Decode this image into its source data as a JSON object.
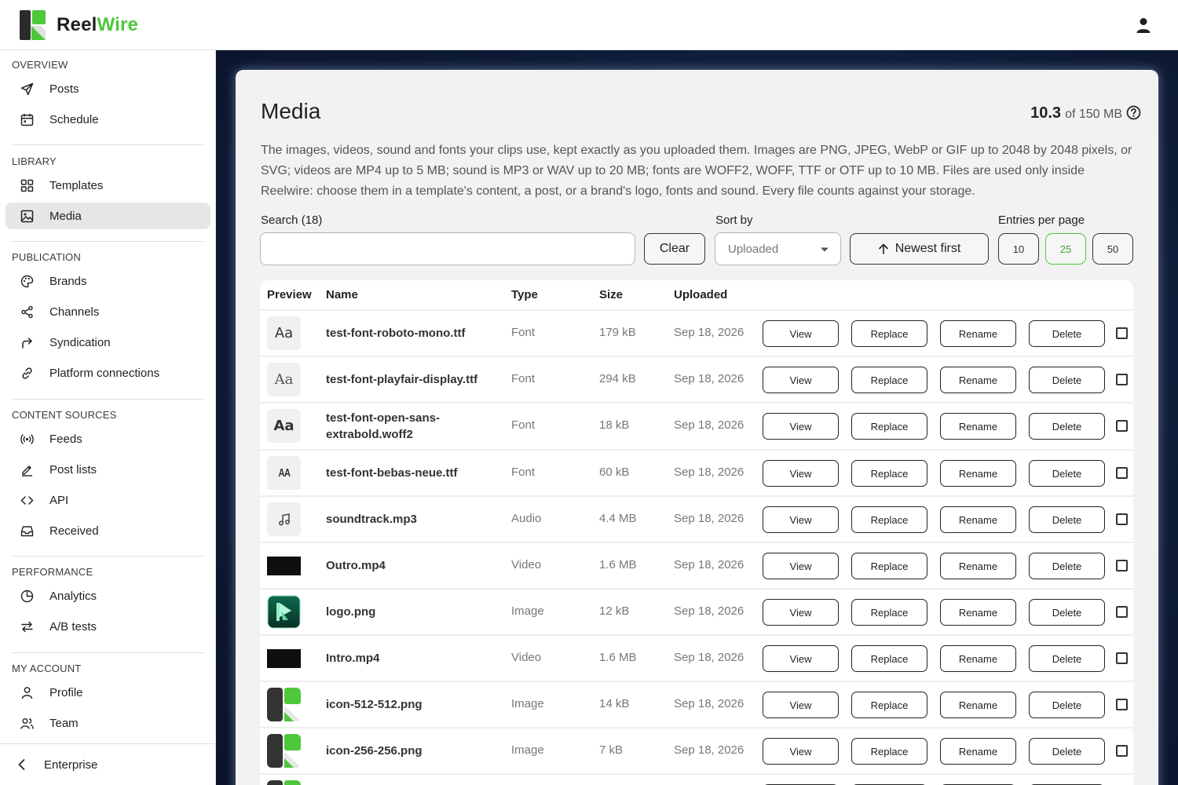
{
  "header": {
    "brand_first": "Reel",
    "brand_second": "Wire",
    "colors": {
      "brand_green": "#4ec73b",
      "brand_dark": "#262626"
    }
  },
  "sidebar": {
    "sections": [
      {
        "title": "OVERVIEW",
        "items": [
          {
            "label": "Posts",
            "icon": "send-icon"
          },
          {
            "label": "Schedule",
            "icon": "calendar-icon"
          }
        ]
      },
      {
        "title": "LIBRARY",
        "items": [
          {
            "label": "Templates",
            "icon": "grid-icon"
          },
          {
            "label": "Media",
            "icon": "image-icon",
            "active": true
          }
        ]
      },
      {
        "title": "PUBLICATION",
        "items": [
          {
            "label": "Brands",
            "icon": "palette-icon"
          },
          {
            "label": "Channels",
            "icon": "share-icon"
          },
          {
            "label": "Syndication",
            "icon": "forward-arrow-icon"
          },
          {
            "label": "Platform connections",
            "icon": "link-icon"
          }
        ]
      },
      {
        "title": "CONTENT SOURCES",
        "items": [
          {
            "label": "Feeds",
            "icon": "broadcast-icon"
          },
          {
            "label": "Post lists",
            "icon": "pencil-icon"
          },
          {
            "label": "API",
            "icon": "code-icon"
          },
          {
            "label": "Received",
            "icon": "inbox-icon"
          }
        ]
      },
      {
        "title": "PERFORMANCE",
        "items": [
          {
            "label": "Analytics",
            "icon": "pie-chart-icon"
          },
          {
            "label": "A/B tests",
            "icon": "swap-icon"
          }
        ]
      },
      {
        "title": "MY ACCOUNT",
        "items": [
          {
            "label": "Profile",
            "icon": "user-icon"
          },
          {
            "label": "Team",
            "icon": "users-icon"
          }
        ]
      }
    ],
    "footer_label": "Enterprise"
  },
  "main": {
    "title": "Media",
    "storage_used": "10.3",
    "storage_total": "of 150 MB",
    "description": "The images, videos, sound and fonts your clips use, kept exactly as you uploaded them. Images are PNG, JPEG, WebP or GIF up to 2048 by 2048 pixels, or SVG; videos are MP4 up to 5 MB; sound is MP3 or WAV up to 20 MB; fonts are WOFF2, WOFF, TTF or OTF up to 10 MB. Files are used only inside Reelwire: choose them in a template's content, a post, or a brand's logo, fonts and sound. Every file counts against your storage.",
    "search_label": "Search (18)",
    "search_value": "",
    "clear_label": "Clear",
    "sort_label": "Sort by",
    "sort_value": "Uploaded",
    "order_label": "Newest first",
    "entries_label": "Entries per page",
    "entries_options": [
      "10",
      "25",
      "50"
    ],
    "entries_selected": "25"
  },
  "table": {
    "columns": [
      "Preview",
      "Name",
      "Type",
      "Size",
      "Uploaded"
    ],
    "actions": [
      "View",
      "Replace",
      "Rename",
      "Delete"
    ],
    "rows": [
      {
        "name": "test-font-roboto-mono.ttf",
        "type": "Font",
        "size": "179 kB",
        "uploaded": "Sep 18, 2026",
        "preview": "Aa",
        "kind": "font",
        "style": "sans"
      },
      {
        "name": "test-font-playfair-display.ttf",
        "type": "Font",
        "size": "294 kB",
        "uploaded": "Sep 18, 2026",
        "preview": "Aa",
        "kind": "font",
        "style": "serif"
      },
      {
        "name": "test-font-open-sans-extrabold.woff2",
        "type": "Font",
        "size": "18 kB",
        "uploaded": "Sep 18, 2026",
        "preview": "Aa",
        "kind": "font",
        "style": "bold"
      },
      {
        "name": "test-font-bebas-neue.ttf",
        "type": "Font",
        "size": "60 kB",
        "uploaded": "Sep 18, 2026",
        "preview": "AA",
        "kind": "font",
        "style": "condensed"
      },
      {
        "name": "soundtrack.mp3",
        "type": "Audio",
        "size": "4.4 MB",
        "uploaded": "Sep 18, 2026",
        "kind": "audio"
      },
      {
        "name": "Outro.mp4",
        "type": "Video",
        "size": "1.6 MB",
        "uploaded": "Sep 18, 2026",
        "kind": "video"
      },
      {
        "name": "logo.png",
        "type": "Image",
        "size": "12 kB",
        "uploaded": "Sep 18, 2026",
        "kind": "logo"
      },
      {
        "name": "Intro.mp4",
        "type": "Video",
        "size": "1.6 MB",
        "uploaded": "Sep 18, 2026",
        "kind": "video"
      },
      {
        "name": "icon-512-512.png",
        "type": "Image",
        "size": "14 kB",
        "uploaded": "Sep 18, 2026",
        "kind": "icon"
      },
      {
        "name": "icon-256-256.png",
        "type": "Image",
        "size": "7 kB",
        "uploaded": "Sep 18, 2026",
        "kind": "icon"
      },
      {
        "name": "",
        "type": "",
        "size": "",
        "uploaded": "",
        "kind": "icon"
      }
    ]
  }
}
